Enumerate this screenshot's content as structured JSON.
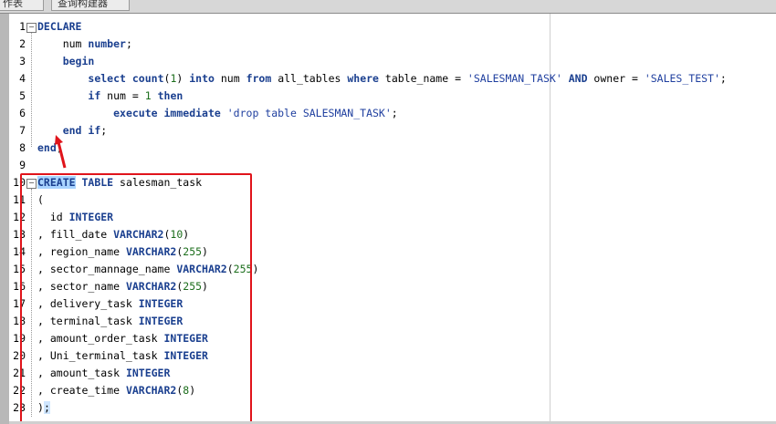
{
  "tabs": [
    "作表",
    "查询构建器"
  ],
  "editor": {
    "line_numbers": [
      "1",
      "2",
      "3",
      "4",
      "5",
      "6",
      "7",
      "8",
      "9",
      "10",
      "11",
      "12",
      "13",
      "14",
      "15",
      "16",
      "17",
      "18",
      "19",
      "20",
      "21",
      "22",
      "23"
    ],
    "fold_markers": [
      "minus",
      "minus"
    ],
    "annotation_color": "#e0141b",
    "lines": [
      "DECLARE",
      "    num number;",
      "    begin",
      "        select count(1) into num from all_tables where table_name = 'SALESMAN_TASK' AND owner = 'SALES_TEST';",
      "        if num = 1 then",
      "            execute immediate 'drop table SALESMAN_TASK';",
      "    end if;",
      "end;",
      "",
      "CREATE TABLE salesman_task",
      "(",
      "  id INTEGER",
      ", fill_date VARCHAR2(10)",
      ", region_name VARCHAR2(255)",
      ", sector_mannage_name VARCHAR2(255)",
      ", sector_name VARCHAR2(255)",
      ", delivery_task INTEGER",
      ", terminal_task INTEGER",
      ", amount_order_task INTEGER",
      ", Uni_terminal_task INTEGER",
      ", amount_task INTEGER",
      ", create_time VARCHAR2(8)",
      ");"
    ]
  }
}
